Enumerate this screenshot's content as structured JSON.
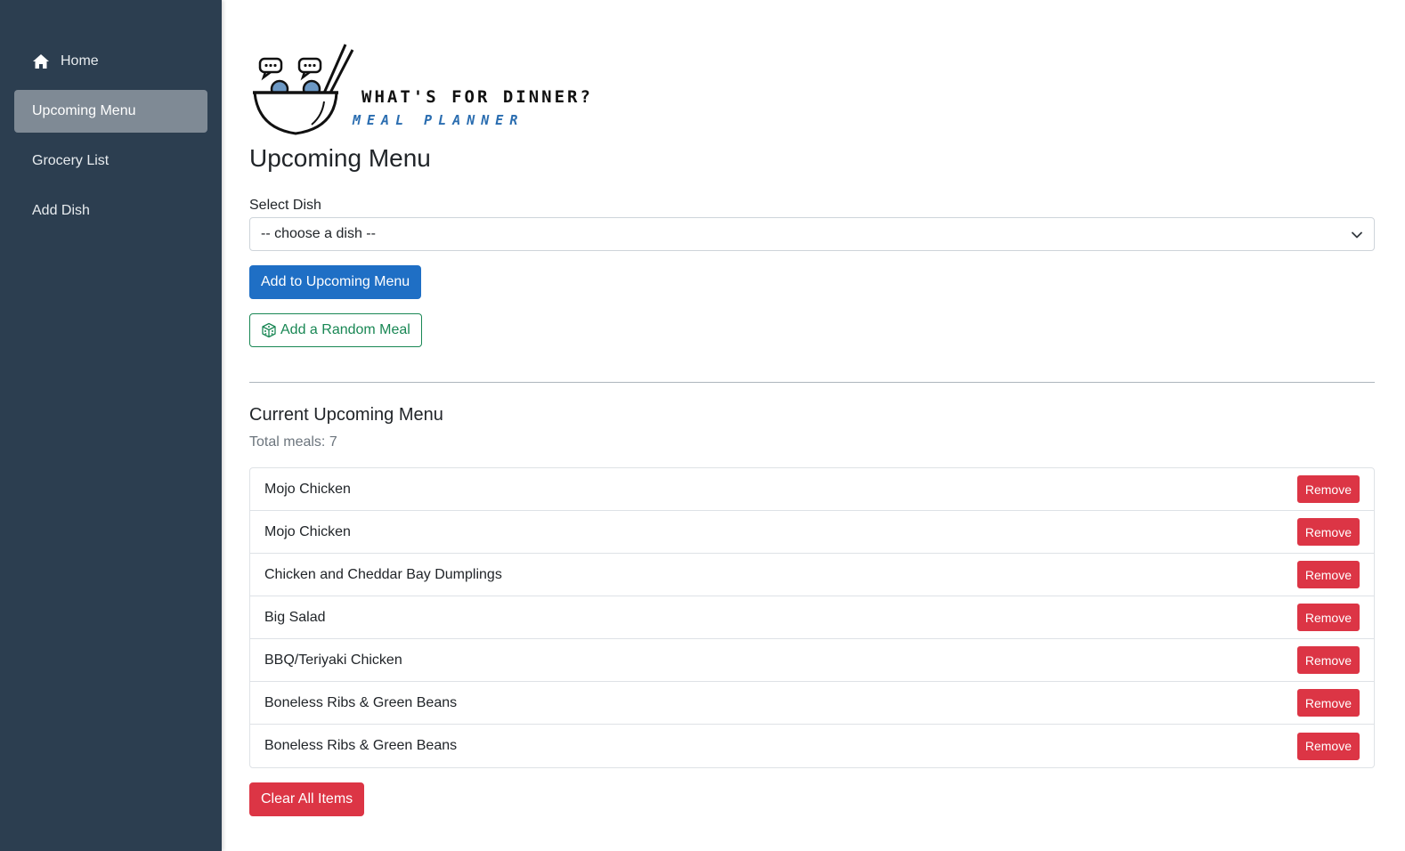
{
  "sidebar": {
    "items": [
      {
        "label": "Home",
        "icon": "home-icon",
        "active": false
      },
      {
        "label": "Upcoming Menu",
        "active": true
      },
      {
        "label": "Grocery List",
        "active": false
      },
      {
        "label": "Add Dish",
        "active": false
      }
    ]
  },
  "logo": {
    "title": "WHAT'S FOR DINNER?",
    "subtitle": "MEAL PLANNER"
  },
  "main": {
    "title": "Upcoming Menu",
    "select_label": "Select Dish",
    "select_value": "-- choose a dish --",
    "add_button": "Add to Upcoming Menu",
    "random_button": "Add a Random Meal",
    "section_title": "Current Upcoming Menu",
    "total": "Total meals: 7",
    "meals": [
      "Mojo Chicken",
      "Mojo Chicken",
      "Chicken and Cheddar Bay Dumplings",
      "Big Salad",
      "BBQ/Teriyaki Chicken",
      "Boneless Ribs & Green Beans",
      "Boneless Ribs & Green Beans"
    ],
    "remove_label": "Remove",
    "clear_button": "Clear All Items"
  },
  "colors": {
    "sidebar_bg": "#2c3e50",
    "active_nav": "#7f8a95",
    "primary": "#1f6fc5",
    "success": "#198754",
    "danger": "#dc3545"
  }
}
